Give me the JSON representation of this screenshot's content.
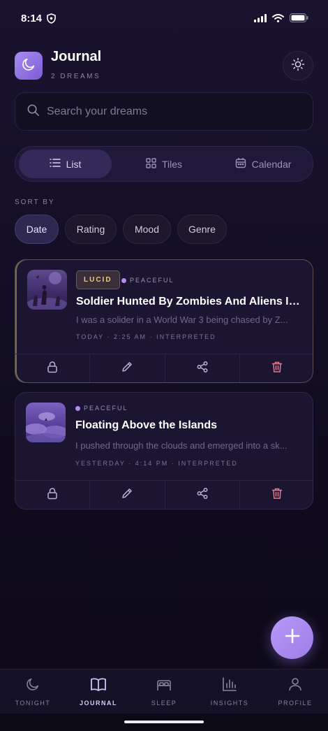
{
  "status_bar": {
    "time": "8:14"
  },
  "header": {
    "title": "Journal",
    "subtitle": "2 DREAMS"
  },
  "search": {
    "placeholder": "Search your dreams"
  },
  "view_toggle": {
    "items": [
      {
        "label": "List",
        "icon": "list-icon",
        "active": true
      },
      {
        "label": "Tiles",
        "icon": "grid-icon",
        "active": false
      },
      {
        "label": "Calendar",
        "icon": "calendar-icon",
        "active": false
      }
    ]
  },
  "sort": {
    "label": "SORT BY",
    "options": [
      "Date",
      "Rating",
      "Mood",
      "Genre"
    ],
    "selected": "Date"
  },
  "entries": [
    {
      "badge": "LUCID",
      "mood": "PEACEFUL",
      "title": "Soldier Hunted By Zombies And Aliens In ...",
      "snippet": "I was a solider in a World War 3 being chased by Z...",
      "date": "TODAY",
      "time": "2:25 AM",
      "status": "INTERPRETED"
    },
    {
      "mood": "PEACEFUL",
      "title": "Floating Above the Islands",
      "snippet": "I pushed through the clouds and emerged into a sk...",
      "date": "YESTERDAY",
      "time": "4:14 PM",
      "status": "INTERPRETED"
    }
  ],
  "tabs": [
    {
      "label": "TONIGHT",
      "icon": "moon-icon",
      "active": false
    },
    {
      "label": "JOURNAL",
      "icon": "book-icon",
      "active": true
    },
    {
      "label": "SLEEP",
      "icon": "bed-icon",
      "active": false
    },
    {
      "label": "INSIGHTS",
      "icon": "bar-chart-icon",
      "active": false
    },
    {
      "label": "PROFILE",
      "icon": "person-icon",
      "active": false
    }
  ],
  "colors": {
    "accent": "#a88cf0",
    "lucid_badge": "#e8c887",
    "delete": "#e07b8c",
    "background": "#140f25"
  }
}
